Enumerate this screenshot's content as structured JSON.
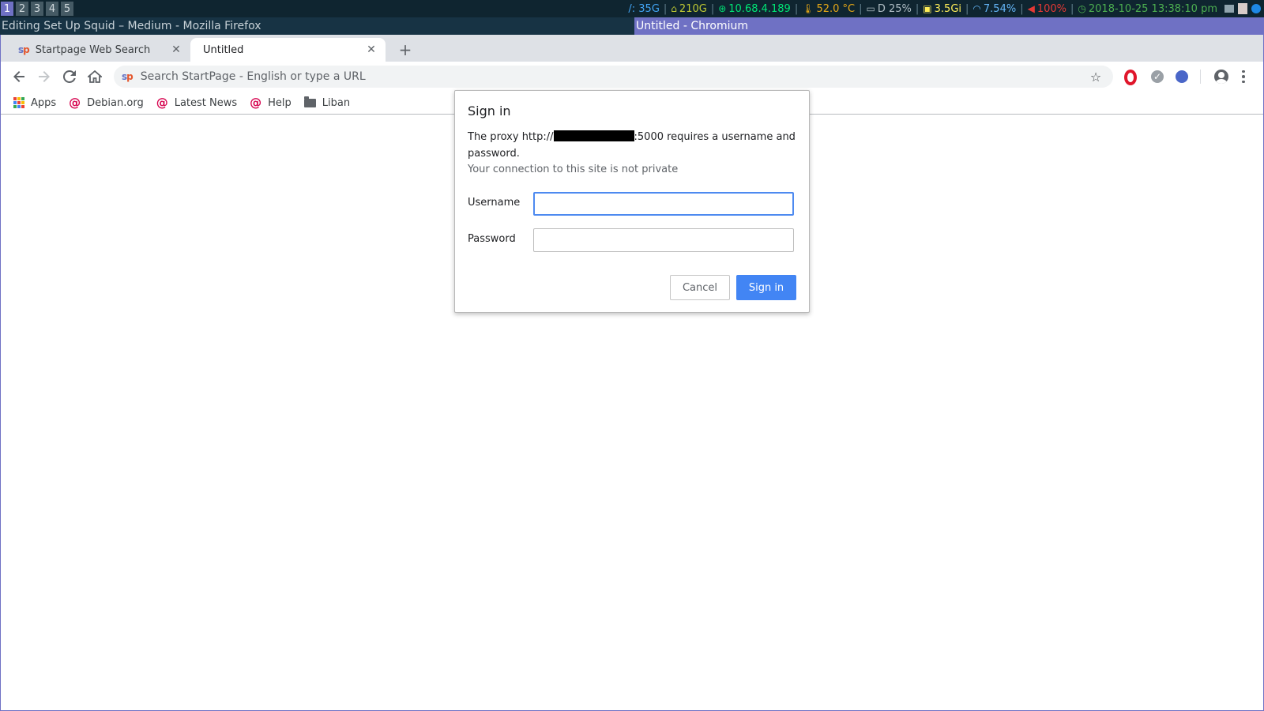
{
  "workspaces": [
    "1",
    "2",
    "3",
    "4",
    "5"
  ],
  "status": {
    "disk_root": "/: 35G",
    "disk_home": "210G",
    "ip": "10.68.4.189",
    "temp": "52.0 °C",
    "battery": "D 25%",
    "memory": "3.5Gi",
    "cpu": "7.54%",
    "volume": "100%",
    "datetime": "2018-10-25 13:38:10 pm"
  },
  "colors": {
    "statusbar_bg": "#0f2530",
    "accent": "#6f71c4",
    "disk_root": "#42a5f5",
    "disk_home": "#c0ca33",
    "ip": "#00e676",
    "temp": "#e6a817",
    "battery": "#b0bec5",
    "memory": "#ffee58",
    "cpu": "#64b5f6",
    "volume": "#e53935",
    "datetime": "#4caf50",
    "primary_button": "#4285f4"
  },
  "windows": {
    "left_title": "Editing Set Up Squid – Medium - Mozilla Firefox",
    "right_title": "Untitled - Chromium"
  },
  "browser": {
    "tabs": [
      {
        "label": "Startpage Web Search",
        "icon": "startpage-icon"
      },
      {
        "label": "Untitled",
        "active": true
      }
    ],
    "omnibox_placeholder": "Search StartPage - English or type a URL",
    "bookmarks": [
      {
        "label": "Apps",
        "icon": "apps-grid-icon"
      },
      {
        "label": "Debian.org",
        "icon": "debian-icon"
      },
      {
        "label": "Latest News",
        "icon": "debian-icon"
      },
      {
        "label": "Help",
        "icon": "debian-icon"
      },
      {
        "label": "Liban",
        "icon": "folder-icon"
      }
    ]
  },
  "dialog": {
    "title": "Sign in",
    "message_prefix": "The proxy http://",
    "message_suffix": ":5000 requires a username and password.",
    "subtext": "Your connection to this site is not private",
    "username_label": "Username",
    "password_label": "Password",
    "username_value": "",
    "password_value": "",
    "cancel_label": "Cancel",
    "signin_label": "Sign in"
  }
}
